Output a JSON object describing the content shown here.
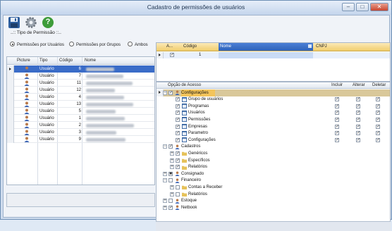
{
  "window": {
    "title": "Cadastro de permissões de usuários",
    "minimize": "–",
    "maximize": "□",
    "close": "✕"
  },
  "toolbar": {
    "save_icon": "floppy-disk-icon",
    "settings_icon": "gear-icon",
    "help_icon": "help-icon",
    "help_label": "?"
  },
  "tipo": {
    "title": "..:: Tipo de Permissão ::..",
    "options": [
      "Permissões por Usuários",
      "Permissões por Grupos",
      "Ambos"
    ],
    "selected": "Permissões por Usuários"
  },
  "users": {
    "columns": [
      "Picture",
      "Tipo",
      "Código",
      "Nome"
    ],
    "rows": [
      {
        "tipo": "Usuário",
        "codigo": "6"
      },
      {
        "tipo": "Usuário",
        "codigo": "7"
      },
      {
        "tipo": "Usuário",
        "codigo": "11"
      },
      {
        "tipo": "Usuário",
        "codigo": "12"
      },
      {
        "tipo": "Usuário",
        "codigo": "4"
      },
      {
        "tipo": "Usuário",
        "codigo": "13"
      },
      {
        "tipo": "Usuário",
        "codigo": "5"
      },
      {
        "tipo": "Usuário",
        "codigo": "1"
      },
      {
        "tipo": "Usuário",
        "codigo": "2"
      },
      {
        "tipo": "Usuário",
        "codigo": "3"
      },
      {
        "tipo": "Usuário",
        "codigo": "9"
      }
    ],
    "selected_index": 0
  },
  "empresas": {
    "columns": [
      "A...",
      "Código",
      "Nome",
      "CNPJ"
    ],
    "rows": [
      {
        "codigo": "1"
      }
    ]
  },
  "permissoes": {
    "columns": [
      "Opção de Acesso",
      "Incluir",
      "Alterar",
      "Deletar"
    ],
    "tree": [
      {
        "label": "Configurações",
        "level": 1,
        "expander": "−",
        "checked": true,
        "icon": "user-icon",
        "header": true,
        "selected": true
      },
      {
        "label": "Grupo de usuários",
        "level": 2,
        "checked": true,
        "icon": "window-icon",
        "actions": [
          true,
          true,
          true
        ]
      },
      {
        "label": "Programas",
        "level": 2,
        "checked": true,
        "icon": "window-icon",
        "actions": [
          true,
          true,
          true
        ]
      },
      {
        "label": "Usuários",
        "level": 2,
        "checked": true,
        "icon": "window-icon",
        "actions": [
          true,
          true,
          true
        ]
      },
      {
        "label": "Permissões",
        "level": 2,
        "checked": true,
        "icon": "window-icon",
        "actions": [
          true,
          true,
          true
        ]
      },
      {
        "label": "Empresas",
        "level": 2,
        "checked": true,
        "icon": "window-icon",
        "actions": [
          true,
          true,
          true
        ]
      },
      {
        "label": "Parametro",
        "level": 2,
        "checked": true,
        "icon": "window-icon",
        "actions": [
          true,
          true,
          true
        ]
      },
      {
        "label": "Configurações",
        "level": 2,
        "checked": true,
        "icon": "window-icon",
        "actions": [
          true,
          true,
          true
        ]
      },
      {
        "label": "Cadastros",
        "level": 1,
        "expander": "−",
        "checked": true,
        "icon": "user-icon"
      },
      {
        "label": "Genéricos",
        "level": 2,
        "expander": "+",
        "checked": true,
        "icon": "folder-icon"
      },
      {
        "label": "Específicos",
        "level": 2,
        "expander": "+",
        "checked": true,
        "icon": "folder-icon"
      },
      {
        "label": "Relatórios",
        "level": 2,
        "expander": "+",
        "checked": true,
        "icon": "folder-icon"
      },
      {
        "label": "Consignado",
        "level": 1,
        "expander": "+",
        "checked": "partial",
        "icon": "user-icon"
      },
      {
        "label": "Financeiro",
        "level": 1,
        "expander": "−",
        "checked": false,
        "icon": "user-icon"
      },
      {
        "label": "Contas a Receber",
        "level": 2,
        "expander": "+",
        "checked": false,
        "icon": "folder-icon"
      },
      {
        "label": "Relatórios",
        "level": 2,
        "expander": "+",
        "checked": false,
        "icon": "folder-icon"
      },
      {
        "label": "Estoque",
        "level": 1,
        "expander": "+",
        "checked": false,
        "icon": "user-icon"
      },
      {
        "label": "Netbook",
        "level": 1,
        "expander": "+",
        "checked": true,
        "icon": "user-icon"
      }
    ]
  },
  "colors": {
    "accent": "#3a6cc8",
    "selection": "#f3c45b",
    "header_row": "#d9c89a"
  }
}
